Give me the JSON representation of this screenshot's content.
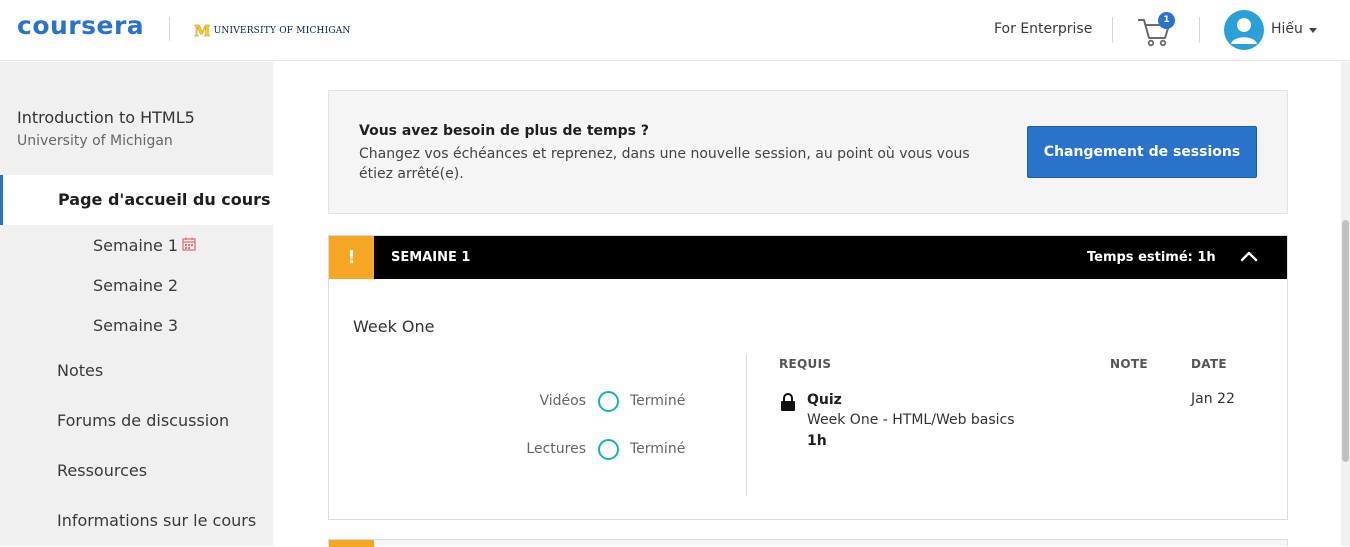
{
  "header": {
    "logo": "coursera",
    "partner": "UNIVERSITY OF MICHIGAN",
    "partner_mark": "M",
    "enterprise_link": "For Enterprise",
    "cart_count": "1",
    "user_name": "Hiếu",
    "brand_color": "#2a73cc"
  },
  "sidebar": {
    "course_title": "Introduction to HTML5",
    "course_institution": "University of Michigan",
    "home_label": "Page d'accueil du cours",
    "weeks": [
      "Semaine 1",
      "Semaine 2",
      "Semaine 3"
    ],
    "items": [
      "Notes",
      "Forums de discussion",
      "Ressources",
      "Informations sur le cours"
    ]
  },
  "banner": {
    "title": "Vous avez besoin de plus de temps ?",
    "text": "Changez vos échéances et reprenez, dans une nouvelle session, au point où vous vous étiez arrêté(e).",
    "button_label": "Changement de sessions"
  },
  "week": {
    "warning_symbol": "!",
    "label": "SEMAINE 1",
    "time_estimate": "Temps estimé: 1h",
    "title": "Week One",
    "progress": [
      {
        "label": "Vidéos",
        "status": "Terminé"
      },
      {
        "label": "Lectures",
        "status": "Terminé"
      }
    ],
    "columns": {
      "requirement": "REQUIS",
      "grade": "NOTE",
      "date": "DATE"
    },
    "requirement": {
      "type": "Quiz",
      "name": "Week One - HTML/Web basics",
      "duration": "1h",
      "date": "Jan 22"
    },
    "accent_color": "#f5a623"
  }
}
